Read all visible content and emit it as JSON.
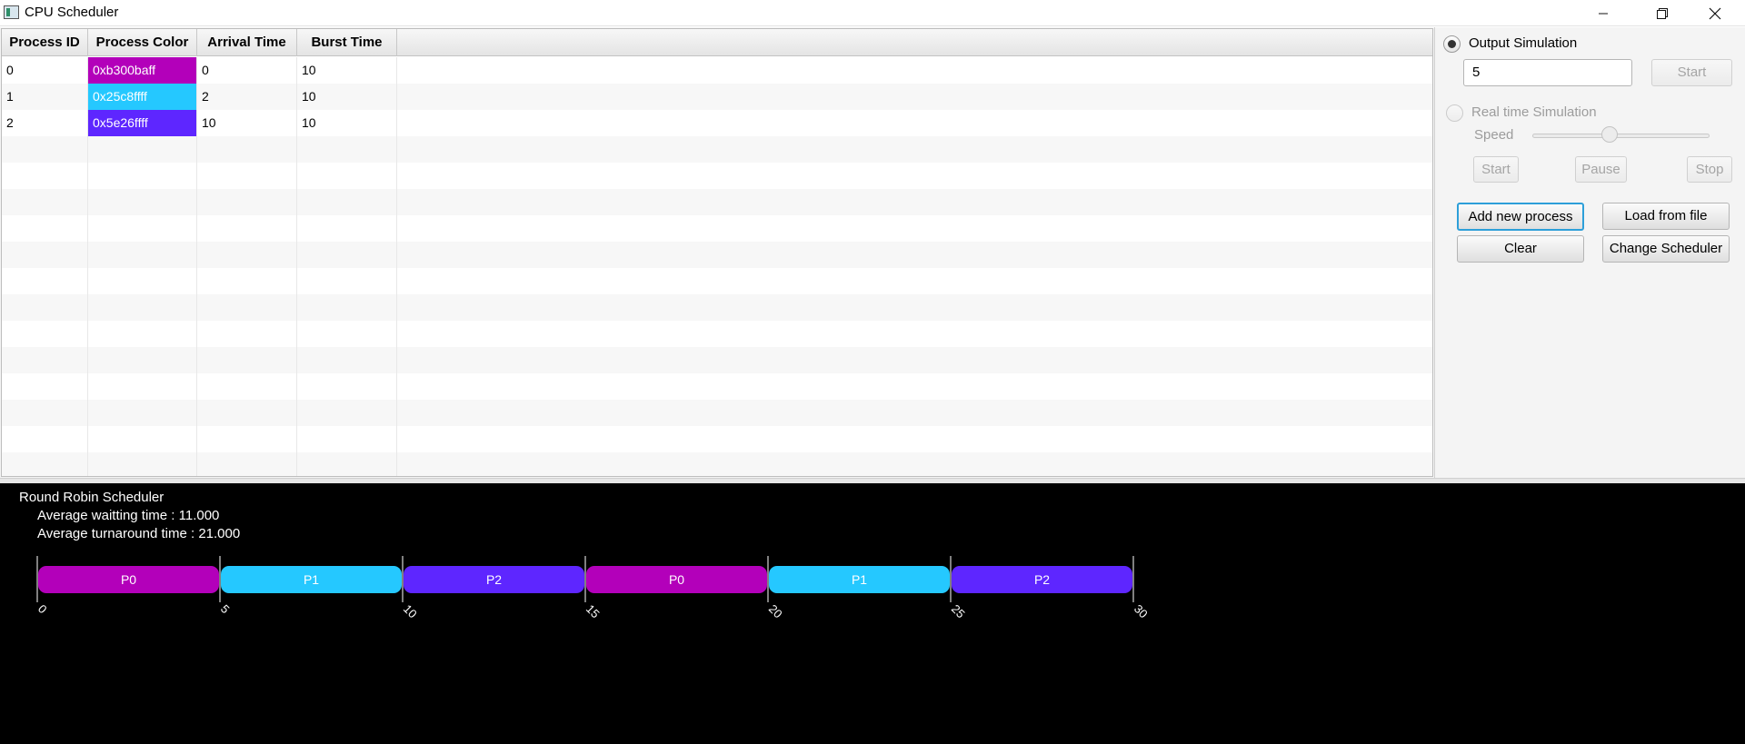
{
  "window": {
    "title": "CPU Scheduler",
    "controls": [
      "minimize-icon",
      "maximize-icon",
      "close-icon"
    ]
  },
  "table": {
    "headers": [
      "Process ID",
      "Process Color",
      "Arrival Time",
      "Burst Time"
    ],
    "rows": [
      {
        "id": "0",
        "color_label": "0xb300baff",
        "color": "#b300ba",
        "arrival": "0",
        "burst": "10"
      },
      {
        "id": "1",
        "color_label": "0x25c8ffff",
        "color": "#25c8ff",
        "arrival": "2",
        "burst": "10"
      },
      {
        "id": "2",
        "color_label": "0x5e26ffff",
        "color": "#5e26ff",
        "arrival": "10",
        "burst": "10"
      }
    ]
  },
  "panel": {
    "output_simulation": {
      "label": "Output Simulation",
      "selected": true,
      "input_value": "5",
      "start_label": "Start",
      "start_enabled": false
    },
    "realtime_simulation": {
      "label": "Real time Simulation",
      "selected": false,
      "enabled": false,
      "speed_label": "Speed",
      "speed_level": 0.43
    },
    "realtime_buttons": {
      "start": "Start",
      "pause": "Pause",
      "stop": "Stop"
    },
    "actions": {
      "add": "Add new process",
      "load": "Load from file",
      "clear": "Clear",
      "change": "Change Scheduler"
    }
  },
  "output": {
    "scheduler_name": "Round Robin Scheduler",
    "avg_waiting": "Average waitting time : 11.000",
    "avg_turnaround": "Average turnaround time : 21.000",
    "gantt": {
      "segments": [
        {
          "label": "P0",
          "start": 0,
          "end": 5,
          "color": "#b300ba"
        },
        {
          "label": "P1",
          "start": 5,
          "end": 10,
          "color": "#25c8ff"
        },
        {
          "label": "P2",
          "start": 10,
          "end": 15,
          "color": "#5e26ff"
        },
        {
          "label": "P0",
          "start": 15,
          "end": 20,
          "color": "#b300ba"
        },
        {
          "label": "P1",
          "start": 20,
          "end": 25,
          "color": "#25c8ff"
        },
        {
          "label": "P2",
          "start": 25,
          "end": 30,
          "color": "#5e26ff"
        }
      ],
      "ticks": [
        "0",
        "5",
        "10",
        "15",
        "20",
        "25",
        "30"
      ]
    }
  },
  "colors": {
    "output_bg": "#000000",
    "focus_border": "#2d9fd9"
  }
}
